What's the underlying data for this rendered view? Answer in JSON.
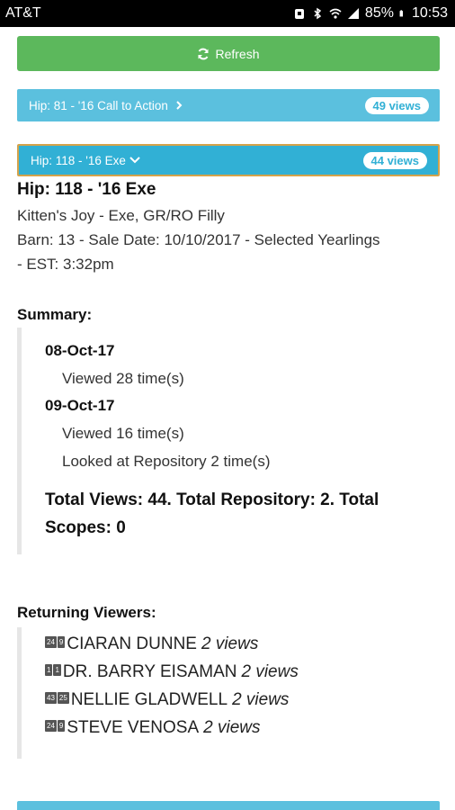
{
  "status_bar": {
    "carrier": "AT&T",
    "battery": "85%",
    "time": "10:53",
    "icons": [
      "notification-icon",
      "bluetooth-icon",
      "wifi-icon",
      "signal-icon",
      "battery-icon"
    ]
  },
  "refresh_button": {
    "label": "Refresh",
    "icon": "refresh-icon"
  },
  "hip_items": [
    {
      "label": "Hip: 81 - '16 Call to Action",
      "views": "49 views",
      "expanded": false
    },
    {
      "label": "Hip: 118 - '16 Exe",
      "views": "44 views",
      "expanded": true
    }
  ],
  "detail": {
    "title": "Hip: 118 - '16 Exe",
    "pedigree": "Kitten's Joy - Exe, GR/RO Filly",
    "barn_line1": "Barn: 13 - Sale Date: 10/10/2017 - Selected Yearlings",
    "barn_line2": "- EST: 3:32pm"
  },
  "summary": {
    "label": "Summary:",
    "days": [
      {
        "date": "08-Oct-17",
        "lines": [
          "Viewed 28 time(s)"
        ]
      },
      {
        "date": "09-Oct-17",
        "lines": [
          "Viewed 16 time(s)",
          "Looked at Repository 2 time(s)"
        ]
      }
    ],
    "totals_line1": "Total Views: 44. Total Repository: 2. Total",
    "totals_line2": "Scopes: 0"
  },
  "returning_viewers": {
    "label": "Returning Viewers:",
    "viewers": [
      {
        "chips": [
          "24",
          "9"
        ],
        "name": "CIARAN DUNNE",
        "views": "2 views"
      },
      {
        "chips": [
          "1",
          "1"
        ],
        "name": "DR. BARRY EISAMAN",
        "views": "2 views"
      },
      {
        "chips": [
          "43",
          "25"
        ],
        "name": "NELLIE GLADWELL",
        "views": "2 views"
      },
      {
        "chips": [
          "24",
          "9"
        ],
        "name": "STEVE VENOSA",
        "views": "2 views"
      }
    ]
  },
  "colors": {
    "success": "#5cb85c",
    "info": "#5bc0de",
    "info_active": "#31b0d5",
    "active_border": "#d4a34b"
  }
}
